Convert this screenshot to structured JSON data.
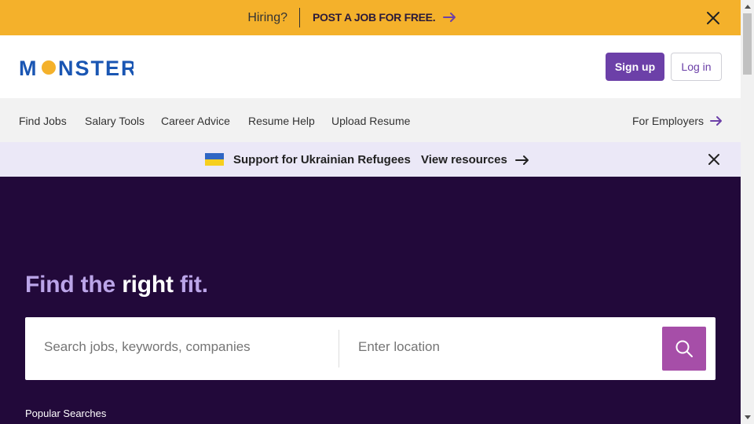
{
  "hire_bar": {
    "question": "Hiring?",
    "cta": "POST A JOB FOR FREE.",
    "bg_color": "#f4b12b",
    "icons": [
      "arrow-right-icon",
      "close-icon"
    ]
  },
  "header": {
    "logo_text": "MONSTER",
    "signup_label": "Sign up",
    "login_label": "Log in",
    "brand_color": "#6c40a8"
  },
  "nav": {
    "items": [
      {
        "label": "Find Jobs"
      },
      {
        "label": "Salary Tools"
      },
      {
        "label": "Career Advice"
      },
      {
        "label": "Resume Help"
      },
      {
        "label": "Upload Resume"
      }
    ],
    "employers_label": "For Employers"
  },
  "ua_banner": {
    "text": "Support for Ukrainian Refugees",
    "link": "View resources",
    "icons": [
      "ukraine-flag-icon",
      "arrow-right-icon",
      "close-icon"
    ]
  },
  "hero": {
    "title_part1": "Find the ",
    "title_part2": "right",
    "title_part3": " fit.",
    "bg_color": "#22093a",
    "search": {
      "keywords_placeholder": "Search jobs, keywords, companies",
      "location_placeholder": "Enter location",
      "button_color": "#a64ea8"
    },
    "popular_label": "Popular Searches"
  }
}
